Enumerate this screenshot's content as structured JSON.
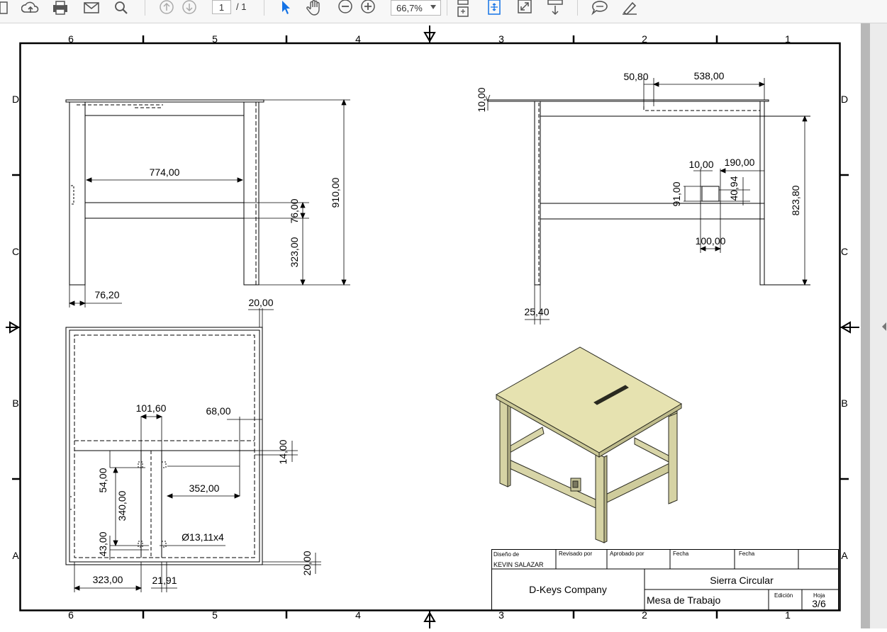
{
  "toolbar": {
    "page_current": "1",
    "page_total": "/ 1",
    "zoom": "66,7%"
  },
  "drawing": {
    "zone_columns": [
      "6",
      "5",
      "4",
      "3",
      "2",
      "1"
    ],
    "zone_rows": [
      "D",
      "C",
      "B",
      "A"
    ],
    "dimensions": {
      "front_width": "774,00",
      "front_height": "910,00",
      "front_rail": "76,00",
      "front_rail_height": "323,00",
      "front_leg": "76,20",
      "top_offset": "20,00",
      "side_top": "10,00",
      "side_offset": "50,80",
      "side_width": "538,00",
      "side_slot_w": "10,00",
      "side_slot_right": "190,00",
      "side_box_h": "91,00",
      "side_box_inner": "40,94",
      "side_box_w": "100,00",
      "side_height": "823,80",
      "side_leg": "25,40",
      "plan_slot_w": "101,60",
      "plan_slot_gap": "68,00",
      "plan_small": "14,00",
      "plan_54": "54,00",
      "plan_340": "340,00",
      "plan_352": "352,00",
      "plan_43": "43,00",
      "plan_hole": "Ø13,11x4",
      "plan_bottom": "20,00",
      "plan_323": "323,00",
      "plan_2191": "21,91"
    }
  },
  "title_block": {
    "drawn_by_label": "Diseño de",
    "drawn_by": "KEVIN SALAZAR",
    "reviewed_label": "Revisado por",
    "approved_label": "Aprobado por",
    "date_label_1": "Fecha",
    "date_label_2": "Fecha",
    "company": "D-Keys Company",
    "project": "Sierra Circular",
    "part": "Mesa de Trabajo",
    "edition_label": "Edición",
    "sheet_label": "Hoja",
    "sheet": "3/6"
  },
  "colors": {
    "tabletop": "#e6e2b0",
    "legs": "#d2cfa0",
    "toolbar_bg": "#f7f7f7",
    "select_tool": "#1473e6"
  },
  "icons": [
    "home-icon",
    "upload-icon",
    "print-icon",
    "email-icon",
    "search-icon",
    "prev-page-icon",
    "next-page-icon",
    "select-tool-icon",
    "hand-tool-icon",
    "zoom-out-icon",
    "zoom-in-icon",
    "fit-page-icon",
    "fit-width-icon",
    "fullscreen-icon",
    "scroll-mode-icon",
    "comment-icon",
    "highlight-icon"
  ]
}
